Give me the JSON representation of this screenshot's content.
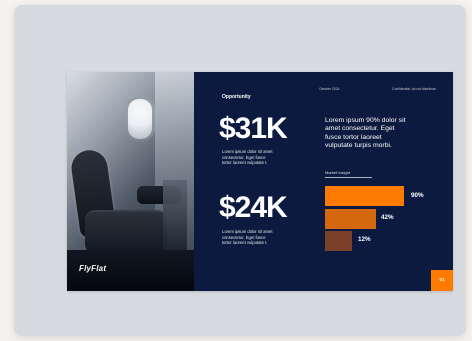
{
  "slide": {
    "brand": "FlyFlat",
    "section_title": "Opportunity",
    "date": "October 2024",
    "confidential": "Confidential, do not distribute",
    "page_number": "01",
    "headline": "Lorem ipsum 90% dolor sit\namet consectetur. Eget\nfusce tortor laoreet\nvulputate turpis morbi.",
    "market_insight_label": "Market Insight",
    "metrics": [
      {
        "value": "$31K",
        "description": "Lorem ipsum dolor sit amet\nconsectetur. Eget fusce\ntortor laoreet vulputate t."
      },
      {
        "value": "$24K",
        "description": "Lorem ipsum dolor sit amet\nconsectetur. Eget fusce\ntortor laoreet vulputate t."
      }
    ],
    "insight_bars": [
      {
        "label": "90%",
        "value": 90,
        "color": "#ff7a00"
      },
      {
        "label": "42%",
        "value": 42,
        "color": "#d5670f"
      },
      {
        "label": "12%",
        "value": 12,
        "color": "#7b4029"
      }
    ]
  }
}
